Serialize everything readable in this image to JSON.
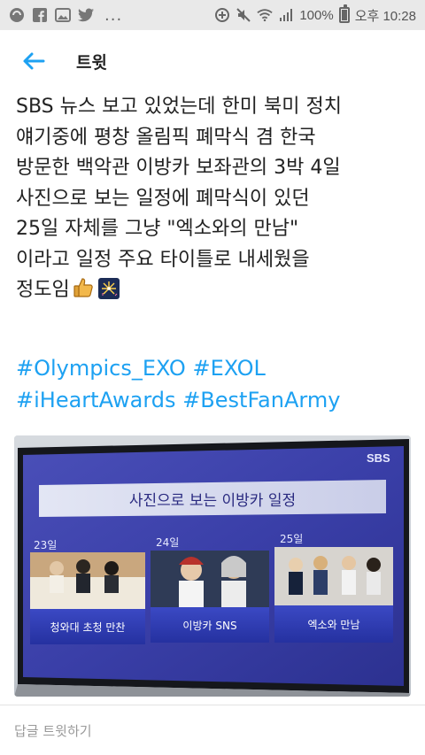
{
  "status_bar": {
    "battery_percent": "100%",
    "time": "오후 10:28",
    "more_indicator": "..."
  },
  "app_bar": {
    "title": "트윗",
    "back_icon": "arrow-left-icon",
    "accent_color": "#1da1f2"
  },
  "tweet": {
    "text_lines": [
      "SBS 뉴스 보고 있었는데 한미 북미 정치",
      "얘기중에  평창 올림픽 폐막식 겸 한국",
      "방문한 백악관 이방카 보좌관의 3박 4일",
      "사진으로 보는 일정에 폐막식이 있던",
      "25일 자체를 그냥 \"엑소와의 만남\"",
      "이라고 일정 주요 타이틀로 내세웠을",
      "정도임"
    ],
    "emojis": [
      "thumbs-up-icon",
      "fireworks-icon"
    ],
    "hashtags": [
      "#Olympics_EXO",
      "#EXOL",
      "#iHeartAwards",
      "#BestFanArmy"
    ]
  },
  "photo": {
    "broadcaster": "SBS",
    "title": "사진으로 보는 이방카 일정",
    "panels": [
      {
        "date": "23일",
        "caption": "청와대 초청 만찬"
      },
      {
        "date": "24일",
        "caption": "이방카 SNS"
      },
      {
        "date": "25일",
        "caption": "엑소와 만남"
      }
    ]
  },
  "reply": {
    "placeholder": "답글 트윗하기"
  }
}
